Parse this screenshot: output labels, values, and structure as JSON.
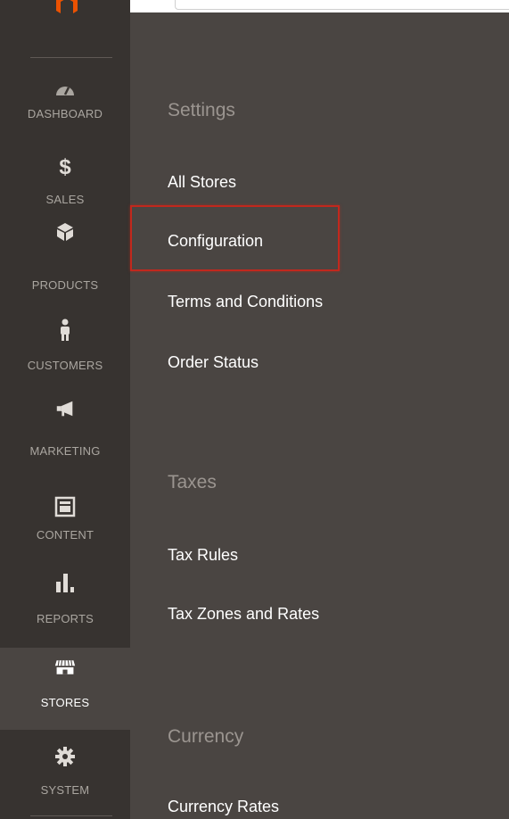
{
  "sidebar": {
    "items": [
      {
        "label": "DASHBOARD",
        "icon": "dashboard-gauge-icon"
      },
      {
        "label": "SALES",
        "icon": "dollar-icon"
      },
      {
        "label": "PRODUCTS",
        "icon": "cube-icon"
      },
      {
        "label": "CUSTOMERS",
        "icon": "person-icon"
      },
      {
        "label": "MARKETING",
        "icon": "megaphone-icon"
      },
      {
        "label": "CONTENT",
        "icon": "layout-icon"
      },
      {
        "label": "REPORTS",
        "icon": "bar-chart-icon"
      },
      {
        "label": "STORES",
        "icon": "storefront-icon",
        "active": true
      },
      {
        "label": "SYSTEM",
        "icon": "gear-icon"
      }
    ]
  },
  "panel": {
    "settings": {
      "title": "Settings",
      "links": [
        "All Stores",
        "Configuration",
        "Terms and Conditions",
        "Order Status"
      ]
    },
    "taxes": {
      "title": "Taxes",
      "links": [
        "Tax Rules",
        "Tax Zones and Rates"
      ]
    },
    "currency": {
      "title": "Currency",
      "links": [
        "Currency Rates"
      ]
    }
  },
  "colors": {
    "sidebar_bg": "#373330",
    "panel_bg": "#4a4542",
    "highlight": "#c2281d",
    "brand": "#eb5202"
  }
}
